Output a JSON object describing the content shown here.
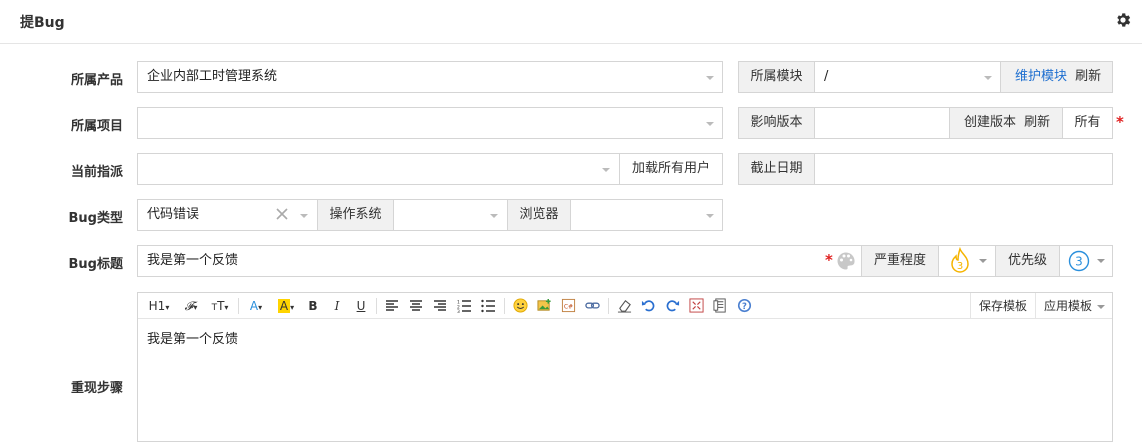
{
  "header": {
    "title": "提Bug",
    "settings_icon": "gear-icon"
  },
  "form": {
    "product": {
      "label": "所属产品",
      "value": "企业内部工时管理系统"
    },
    "module": {
      "label": "所属模块",
      "value": "/",
      "maintain_label": "维护模块",
      "refresh_label": "刷新"
    },
    "project": {
      "label": "所属项目",
      "value": ""
    },
    "build": {
      "label": "影响版本",
      "value": "",
      "create_label": "创建版本",
      "refresh_label": "刷新",
      "all_label": "所有",
      "required_mark": "*"
    },
    "assigned": {
      "label": "当前指派",
      "value": "",
      "load_all_label": "加载所有用户"
    },
    "deadline": {
      "label": "截止日期",
      "value": ""
    },
    "type": {
      "label": "Bug类型",
      "value": "代码错误",
      "clear_icon": "close-icon"
    },
    "os": {
      "label": "操作系统",
      "value": ""
    },
    "browser": {
      "label": "浏览器",
      "value": ""
    },
    "title": {
      "label": "Bug标题",
      "value": "我是第一个反馈",
      "required_mark": "*",
      "color_icon": "palette-icon"
    },
    "severity": {
      "label": "严重程度",
      "value": "3",
      "icon": "flame-icon"
    },
    "priority": {
      "label": "优先级",
      "value": "3"
    },
    "steps": {
      "label": "重现步骤",
      "content": "我是第一个反馈",
      "toolbar": {
        "heading": "H1",
        "save_template": "保存模板",
        "apply_template": "应用模板"
      }
    }
  },
  "colors": {
    "accent": "#1e6fd0",
    "required": "#e02020",
    "severity": "#f5b400",
    "priority": "#2a8fdc"
  }
}
